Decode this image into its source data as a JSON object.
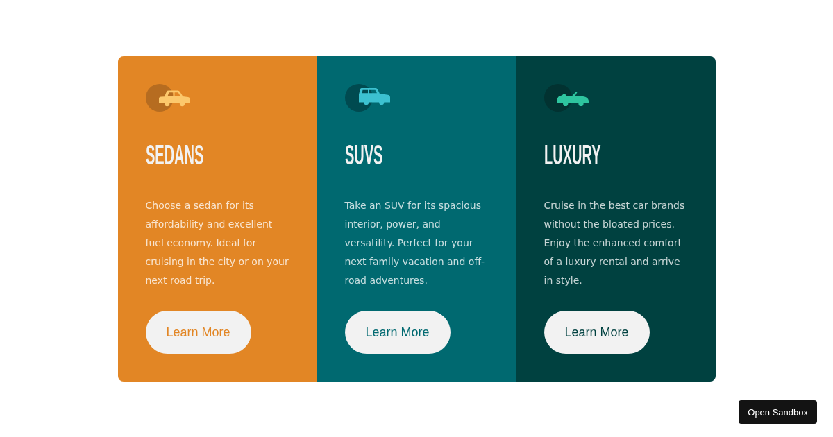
{
  "cards": [
    {
      "kind": "sedan",
      "color": "#e28625",
      "title": "SEDANS",
      "text": "Choose a sedan for its affordability and excellent fuel economy. Ideal for cruising in the city or on your next road trip.",
      "button": "Learn More"
    },
    {
      "kind": "suv",
      "color": "#006970",
      "title": "SUVS",
      "text": "Take an SUV for its spacious interior, power, and versatility. Perfect for your next family vacation and off-road adventures.",
      "button": "Learn More"
    },
    {
      "kind": "luxury",
      "color": "#004140",
      "title": "LUXURY",
      "text": "Cruise in the best car brands without the bloated prices. Enjoy the enhanced comfort of a luxury rental and arrive in style.",
      "button": "Learn More"
    }
  ],
  "sandbox_button": {
    "label": "Open Sandbox"
  }
}
